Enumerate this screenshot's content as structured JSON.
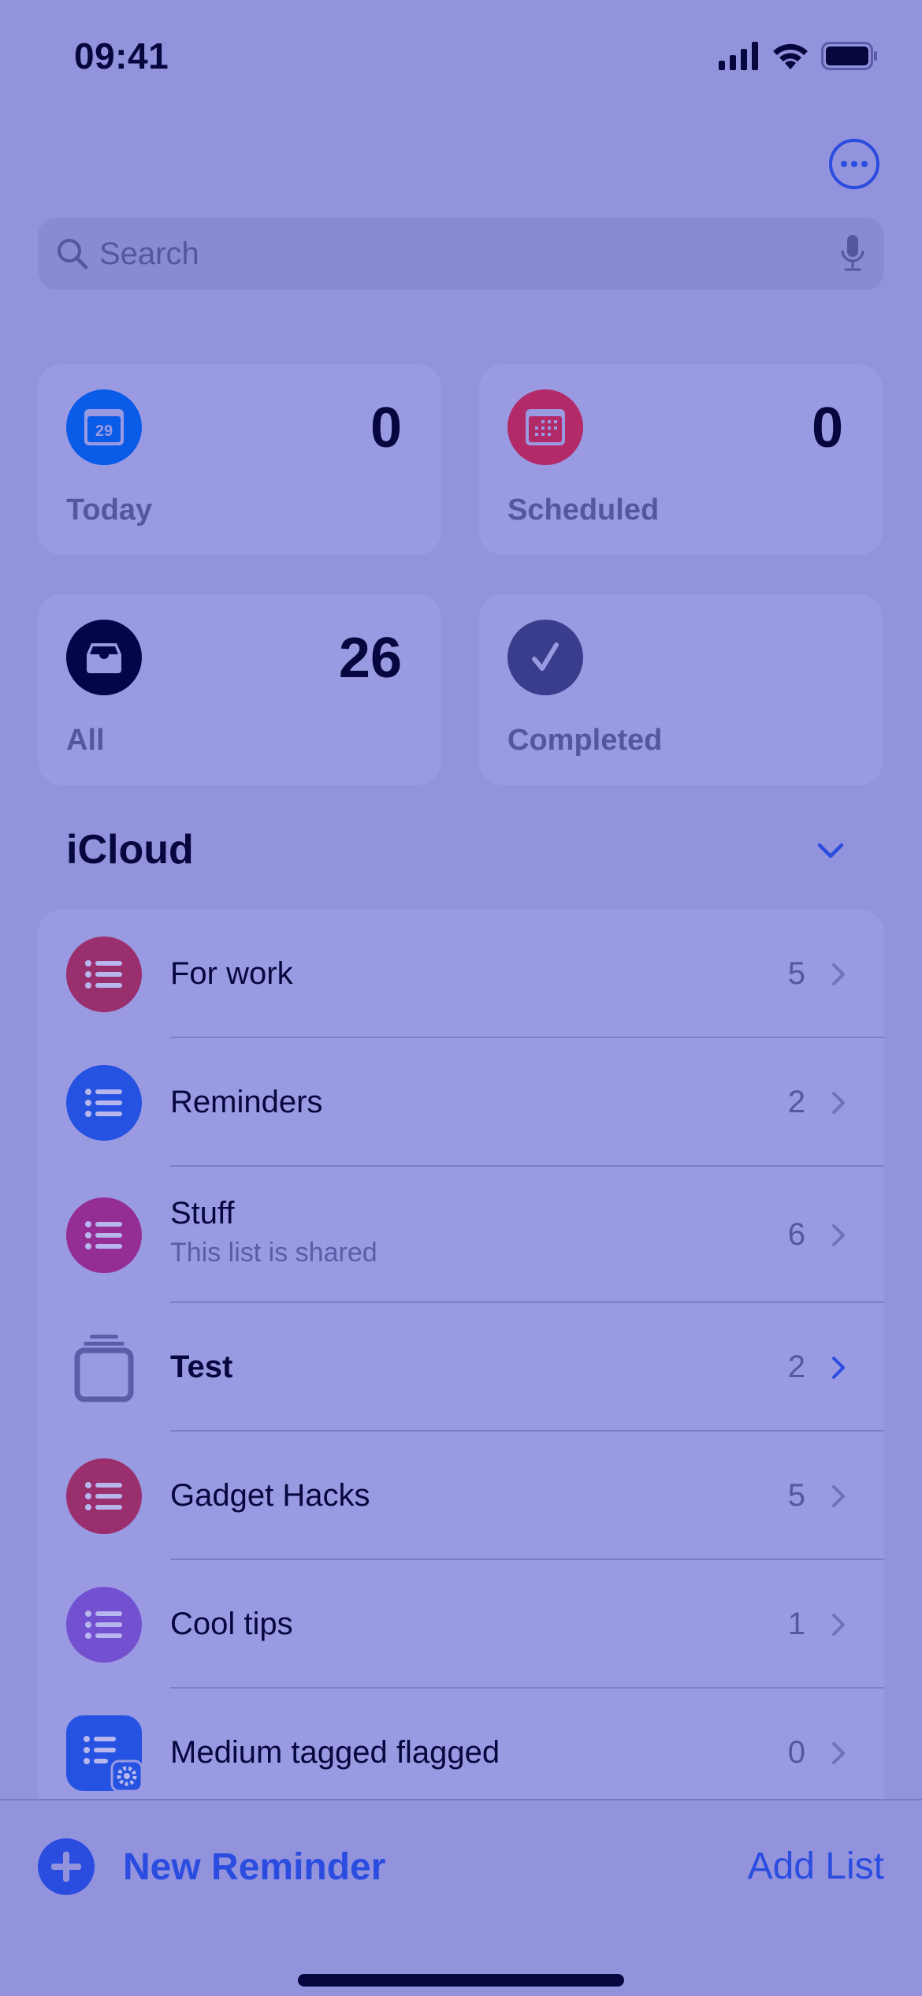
{
  "status_bar": {
    "time": "09:41",
    "icons": [
      "cellular-signal-icon",
      "wifi-icon",
      "battery-icon"
    ]
  },
  "header": {
    "more_button_icon": "ellipsis-circle-icon"
  },
  "search": {
    "placeholder": "Search",
    "value": "",
    "icon": "magnifying-glass-icon",
    "mic_icon": "microphone-icon"
  },
  "smart_lists": [
    {
      "label": "Today",
      "count": "0",
      "icon": "calendar-day-icon",
      "icon_text": "29",
      "color": "#0a5be8"
    },
    {
      "label": "Scheduled",
      "count": "0",
      "icon": "calendar-grid-icon",
      "color": "#b22a68"
    },
    {
      "label": "All",
      "count": "26",
      "icon": "tray-icon",
      "color": "#05054a"
    },
    {
      "label": "Completed",
      "count": "",
      "icon": "checkmark-icon",
      "color": "#3a3d8c"
    }
  ],
  "section": {
    "title": "iCloud",
    "toggle_icon": "chevron-down-icon"
  },
  "lists": [
    {
      "title": "For work",
      "subtitle": "",
      "count": "5",
      "icon": "list-bullet-icon",
      "color": "#9a2f6e",
      "shape": "circle"
    },
    {
      "title": "Reminders",
      "subtitle": "",
      "count": "2",
      "icon": "list-bullet-icon",
      "color": "#2552e0",
      "shape": "circle"
    },
    {
      "title": "Stuff",
      "subtitle": "This list is shared",
      "count": "6",
      "icon": "list-bullet-icon",
      "color": "#952e94",
      "shape": "circle"
    },
    {
      "title": "Test",
      "subtitle": "",
      "count": "2",
      "icon": "list-group-stack-icon",
      "color": "#5a5ea8",
      "shape": "group",
      "bold": true,
      "chevron_accent": true
    },
    {
      "title": "Gadget Hacks",
      "subtitle": "",
      "count": "5",
      "icon": "list-bullet-icon",
      "color": "#9a2f6e",
      "shape": "circle"
    },
    {
      "title": "Cool tips",
      "subtitle": "",
      "count": "1",
      "icon": "list-bullet-icon",
      "color": "#7350d0",
      "shape": "circle"
    },
    {
      "title": "Medium tagged flagged",
      "subtitle": "",
      "count": "0",
      "icon": "smart-list-gear-icon",
      "color": "#2552e0",
      "shape": "smart"
    }
  ],
  "toolbar": {
    "new_reminder_label": "New Reminder",
    "new_reminder_icon": "plus-circle-icon",
    "add_list_label": "Add List"
  },
  "colors": {
    "background": "#9393dd",
    "card": "#9a9ae2",
    "accent": "#2a4de0",
    "text_primary": "#07073f",
    "text_secondary": "#5656a0"
  }
}
